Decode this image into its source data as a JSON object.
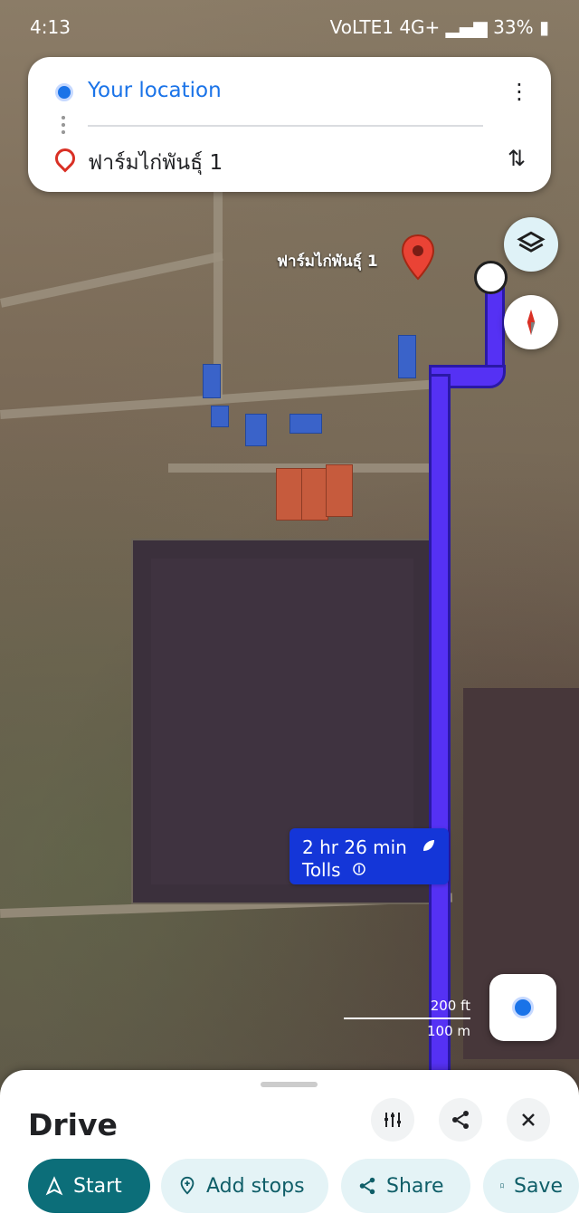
{
  "status_bar": {
    "time": "4:13",
    "network": "VoLTE1 4G+",
    "battery": "33%"
  },
  "search": {
    "origin": "Your location",
    "destination": "ฟาร์มไก่พันธุ์ 1"
  },
  "map": {
    "pin_label": "ฟาร์มไก่พันธุ์ 1",
    "route_time": "2 hr 26 min",
    "route_tolls": "Tolls",
    "scale_ft": "200 ft",
    "scale_m": "100 m"
  },
  "sheet": {
    "title": "Drive",
    "buttons": {
      "start": "Start",
      "add_stops": "Add stops",
      "share": "Share",
      "save": "Save"
    }
  },
  "colors": {
    "route": "#5531f4",
    "primary_blue": "#1a73e8",
    "teal": "#0c6e79",
    "chip": "#1436d8"
  }
}
